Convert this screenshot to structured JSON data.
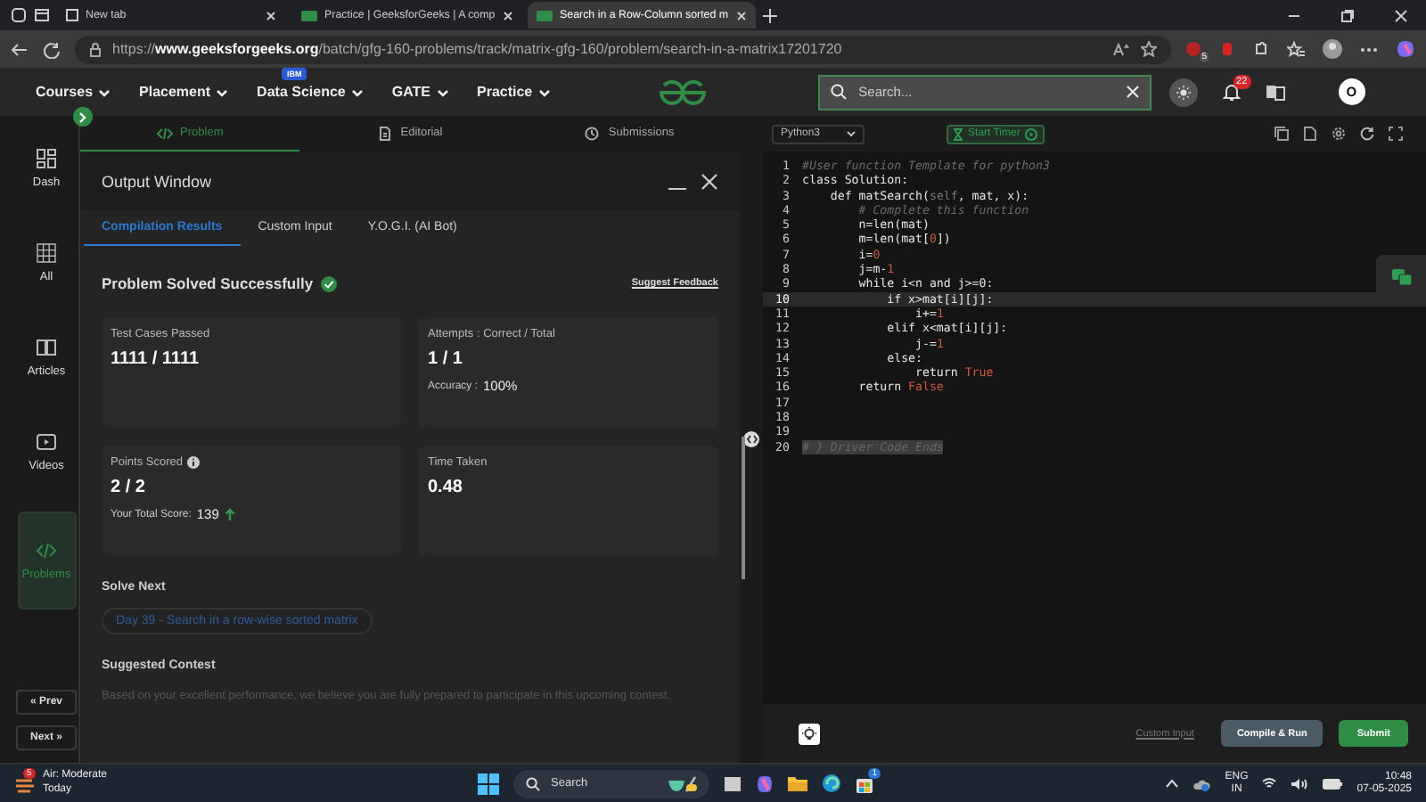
{
  "browser": {
    "tabs": [
      {
        "title": "New tab",
        "selected": false
      },
      {
        "title": "Practice | GeeksforGeeks | A comp",
        "selected": false
      },
      {
        "title": "Search in a Row-Column sorted m",
        "selected": true
      }
    ],
    "url": "https://**www.geeksforgeeks.org**/batch/gfg-160-problems/track/matrix-gfg-160/problem/search-in-a-matrix17201720",
    "extension_badge": "5"
  },
  "nav": {
    "items": [
      {
        "label": "Courses"
      },
      {
        "label": "Placement"
      },
      {
        "label": "Data Science",
        "badge": "IBM"
      },
      {
        "label": "GATE"
      },
      {
        "label": "Practice"
      }
    ],
    "search": {
      "placeholder": "Search..."
    },
    "notifications": "22",
    "avatar": "O"
  },
  "sidebar": {
    "items": [
      {
        "label": "Dash",
        "kind": "dash",
        "selected": false
      },
      {
        "label": "All",
        "kind": "grid",
        "selected": false
      },
      {
        "label": "Articles",
        "kind": "book",
        "selected": false
      },
      {
        "label": "Videos",
        "kind": "video",
        "selected": false
      },
      {
        "label": "Problems",
        "kind": "code",
        "selected": true
      }
    ],
    "prev": "« Prev",
    "next": "Next »"
  },
  "problem_tabs": [
    {
      "label": "Problem",
      "kind": "code",
      "selected": true
    },
    {
      "label": "Editorial",
      "kind": "doc",
      "selected": false
    },
    {
      "label": "Submissions",
      "kind": "clock",
      "selected": false
    }
  ],
  "output": {
    "title": "Output Window",
    "tabs": [
      {
        "label": "Compilation Results",
        "selected": true
      },
      {
        "label": "Custom Input",
        "selected": false
      },
      {
        "label": "Y.O.G.I. (AI Bot)",
        "selected": false
      }
    ],
    "status": "Problem Solved Successfully",
    "feedback": "Suggest Feedback",
    "cards": [
      {
        "label": "Test Cases Passed",
        "value": "1111 / 1111",
        "info": false
      },
      {
        "label": "Attempts : Correct / Total",
        "value": "1 / 1",
        "info": false,
        "note_label": "Accuracy :",
        "note_value": "100%",
        "trend_up": false
      },
      {
        "label": "Points Scored",
        "value": "2 / 2",
        "info": true,
        "note_label": "Your Total Score:",
        "note_value": "139",
        "trend_up": true
      },
      {
        "label": "Time Taken",
        "value": "0.48",
        "info": false
      }
    ],
    "solve_next": {
      "heading": "Solve Next",
      "link": "Day 39 - Search in a row-wise sorted matrix"
    },
    "contest": {
      "heading": "Suggested Contest",
      "text": "Based on your excellent performance, we believe you are fully prepared to participate in this upcoming contest."
    }
  },
  "editor": {
    "language": "Python3",
    "timer": "Start Timer",
    "lines": [
      {
        "number": "1",
        "active": false,
        "tokens": [
          {
            "kind": "comment",
            "text": "#User function Template for python3"
          }
        ]
      },
      {
        "number": "2",
        "active": false,
        "tokens": [
          {
            "kind": "plain",
            "text": "class Solution:"
          }
        ]
      },
      {
        "number": "3",
        "active": false,
        "tokens": [
          {
            "kind": "plain",
            "text": "    def matSearch("
          },
          {
            "kind": "self",
            "text": "self"
          },
          {
            "kind": "plain",
            "text": ", mat, x):"
          }
        ]
      },
      {
        "number": "4",
        "active": false,
        "tokens": [
          {
            "kind": "comment",
            "text": "        # Complete this function"
          }
        ]
      },
      {
        "number": "5",
        "active": false,
        "tokens": [
          {
            "kind": "plain",
            "text": "        n=len(mat)"
          }
        ]
      },
      {
        "number": "6",
        "active": false,
        "tokens": [
          {
            "kind": "plain",
            "text": "        m=len(mat["
          },
          {
            "kind": "number",
            "text": "0"
          },
          {
            "kind": "plain",
            "text": "])"
          }
        ]
      },
      {
        "number": "7",
        "active": false,
        "tokens": [
          {
            "kind": "plain",
            "text": "        i="
          },
          {
            "kind": "number",
            "text": "0"
          }
        ]
      },
      {
        "number": "8",
        "active": false,
        "tokens": [
          {
            "kind": "plain",
            "text": "        j=m-"
          },
          {
            "kind": "number",
            "text": "1"
          }
        ]
      },
      {
        "number": "9",
        "active": false,
        "tokens": [
          {
            "kind": "plain",
            "text": "        while i<n and j>=0:"
          }
        ]
      },
      {
        "number": "10",
        "active": true,
        "tokens": [
          {
            "kind": "plain",
            "text": "            if x>mat[i][j]:"
          }
        ]
      },
      {
        "number": "11",
        "active": false,
        "tokens": [
          {
            "kind": "plain",
            "text": "                i+="
          },
          {
            "kind": "number",
            "text": "1"
          }
        ]
      },
      {
        "number": "12",
        "active": false,
        "tokens": [
          {
            "kind": "plain",
            "text": "            elif x<mat[i][j]:"
          }
        ]
      },
      {
        "number": "13",
        "active": false,
        "tokens": [
          {
            "kind": "plain",
            "text": "                j-="
          },
          {
            "kind": "number",
            "text": "1"
          }
        ]
      },
      {
        "number": "14",
        "active": false,
        "tokens": [
          {
            "kind": "plain",
            "text": "            else:"
          }
        ]
      },
      {
        "number": "15",
        "active": false,
        "tokens": [
          {
            "kind": "plain",
            "text": "                return "
          },
          {
            "kind": "keyword",
            "text": "True"
          }
        ]
      },
      {
        "number": "16",
        "active": false,
        "tokens": [
          {
            "kind": "plain",
            "text": "        return "
          },
          {
            "kind": "keyword",
            "text": "False"
          }
        ]
      },
      {
        "number": "17",
        "active": false
      },
      {
        "number": "18",
        "active": false
      },
      {
        "number": "19",
        "active": false
      },
      {
        "number": "20",
        "active": false,
        "tokens": [
          {
            "kind": "folded",
            "text": "# } Driver Code Ends"
          }
        ]
      }
    ],
    "custom_input": "Custom Input",
    "compile": "Compile & Run",
    "submit": "Submit"
  },
  "taskbar": {
    "weather": {
      "badge": "5",
      "title": "Air: Moderate",
      "subtitle": "Today"
    },
    "search": {
      "placeholder": "Search"
    },
    "store_badge": "1",
    "language": "ENG",
    "region": "IN",
    "time": "10:48",
    "date": "07-05-2025"
  }
}
